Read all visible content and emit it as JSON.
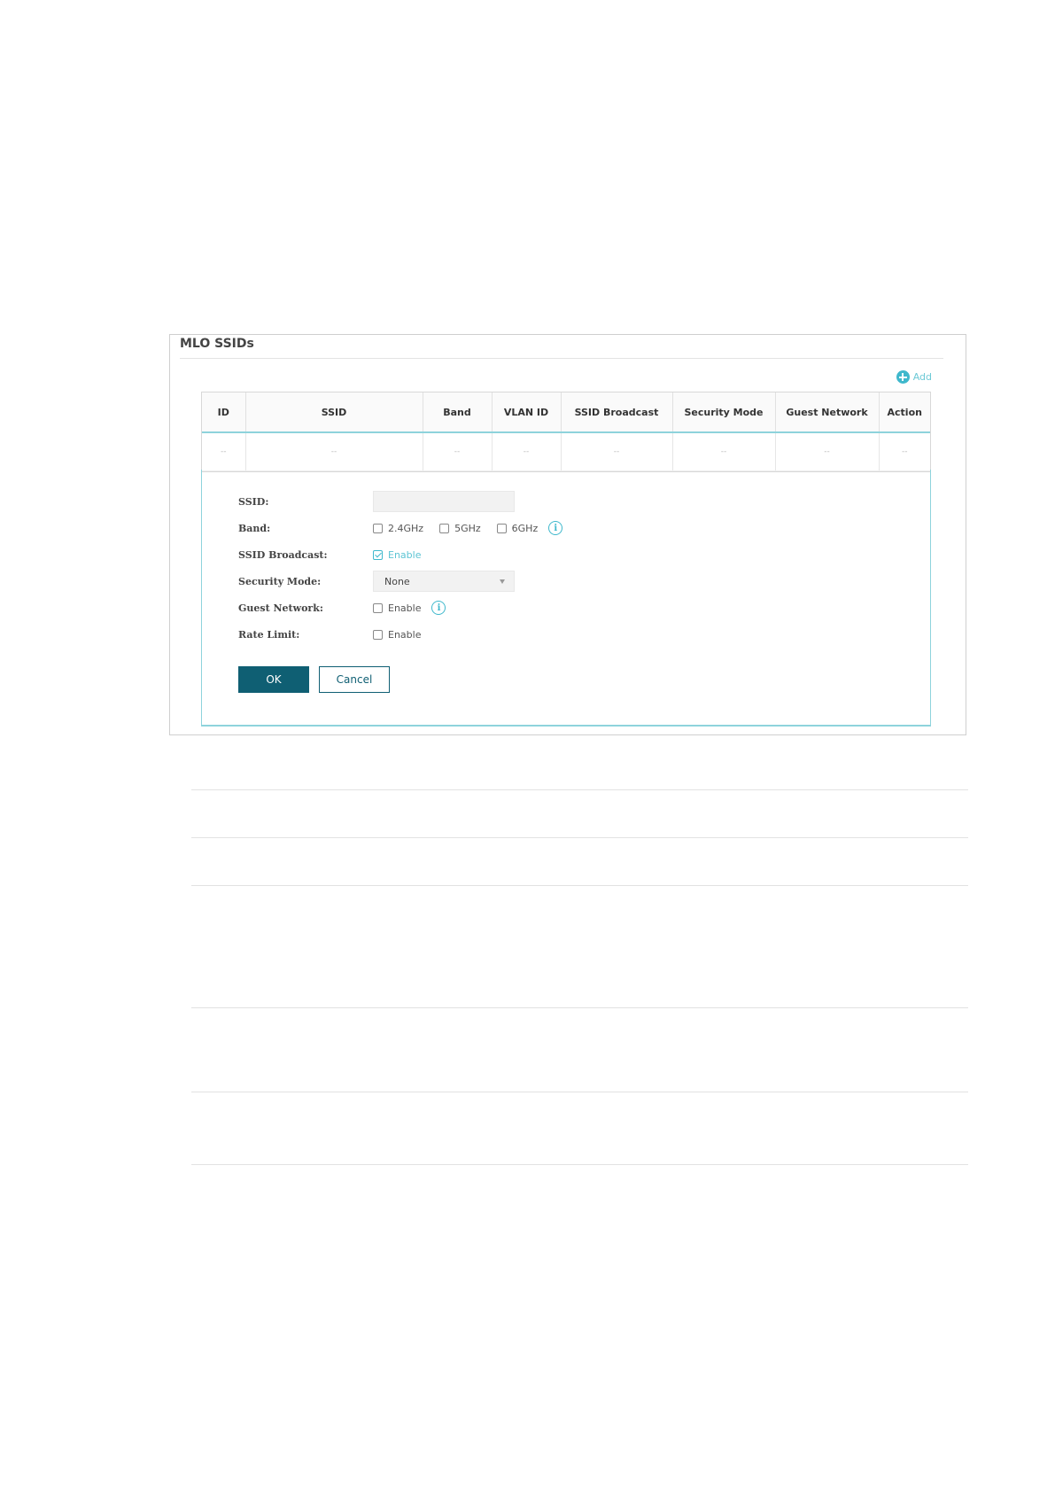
{
  "panel": {
    "title": "MLO SSIDs",
    "add_label": "Add"
  },
  "table": {
    "columns": [
      "ID",
      "SSID",
      "Band",
      "VLAN ID",
      "SSID Broadcast",
      "Security Mode",
      "Guest Network",
      "Action"
    ],
    "rows": [
      [
        "--",
        "--",
        "--",
        "--",
        "--",
        "--",
        "--",
        "--"
      ]
    ]
  },
  "form": {
    "ssid": {
      "label": "SSID:",
      "value": ""
    },
    "band": {
      "label": "Band:",
      "options": [
        {
          "label": "2.4GHz",
          "checked": false
        },
        {
          "label": "5GHz",
          "checked": false
        },
        {
          "label": "6GHz",
          "checked": false
        }
      ]
    },
    "ssid_broadcast": {
      "label": "SSID Broadcast:",
      "option_label": "Enable",
      "checked": true
    },
    "security_mode": {
      "label": "Security Mode:",
      "value": "None"
    },
    "guest_network": {
      "label": "Guest Network:",
      "option_label": "Enable",
      "checked": false
    },
    "rate_limit": {
      "label": "Rate Limit:",
      "option_label": "Enable",
      "checked": false
    },
    "ok_label": "OK",
    "cancel_label": "Cancel"
  },
  "colors": {
    "accent": "#3fb8cc",
    "primary_button": "#0f5f73"
  },
  "icons": {
    "add": "plus-circle-icon",
    "info": "info-circle-icon",
    "dropdown": "chevron-down-icon"
  }
}
